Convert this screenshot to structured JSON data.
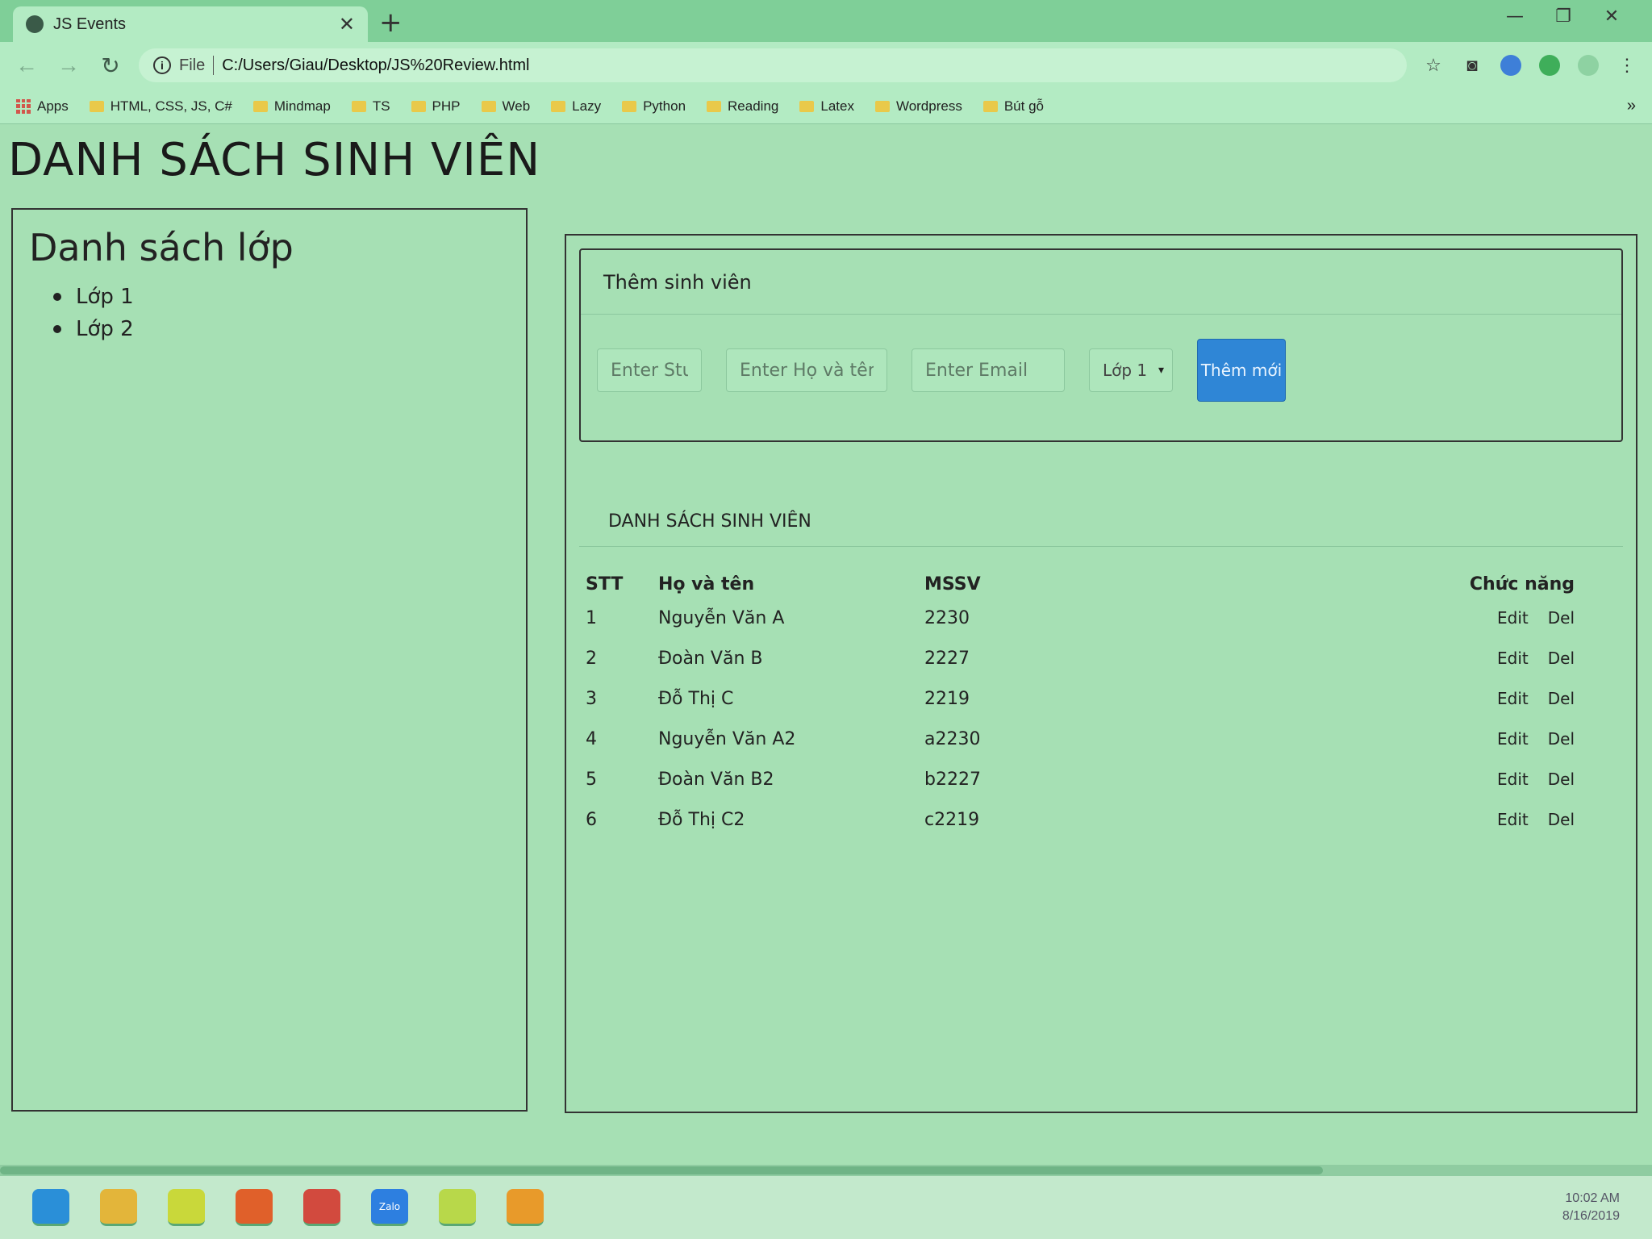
{
  "browser": {
    "tab_title": "JS Events",
    "tab_close": "✕",
    "new_tab": "+",
    "omnibox_scheme": "File",
    "url": "C:/Users/Giau/Desktop/JS%20Review.html",
    "bookmarks": [
      "Apps",
      "HTML, CSS, JS, C#",
      "Mindmap",
      "TS",
      "PHP",
      "Web",
      "Lazy",
      "Python",
      "Reading",
      "Latex",
      "Wordpress",
      "Bút gỗ"
    ],
    "bookmarks_more": "»"
  },
  "page": {
    "title": "DANH SÁCH SINH VIÊN",
    "sidebar": {
      "heading": "Danh sách lớp",
      "classes": [
        "Lớp 1",
        "Lớp 2"
      ]
    },
    "add_form": {
      "header": "Thêm sinh viên",
      "id_placeholder": "Enter Student ID",
      "name_placeholder": "Enter Họ và tên",
      "email_placeholder": "Enter Email",
      "class_selected": "Lớp 1",
      "submit_label": "Thêm mới"
    },
    "list": {
      "header": "DANH SÁCH SINH VIÊN",
      "columns": [
        "STT",
        "Họ và tên",
        "MSSV",
        "Chức năng"
      ],
      "edit_label": "Edit",
      "del_label": "Del",
      "rows": [
        {
          "stt": "1",
          "name": "Nguyễn Văn A",
          "mssv": "2230"
        },
        {
          "stt": "2",
          "name": "Đoàn Văn B",
          "mssv": "2227"
        },
        {
          "stt": "3",
          "name": "Đỗ Thị C",
          "mssv": "2219"
        },
        {
          "stt": "4",
          "name": "Nguyễn Văn A2",
          "mssv": "a2230"
        },
        {
          "stt": "5",
          "name": "Đoàn Văn B2",
          "mssv": "b2227"
        },
        {
          "stt": "6",
          "name": "Đỗ Thị C2",
          "mssv": "c2219"
        }
      ]
    }
  },
  "taskbar": {
    "time": "10:02 AM",
    "date": "8/16/2019",
    "apps": [
      "edge-icon",
      "file-explorer-icon",
      "sticky-notes-icon",
      "firefox-icon",
      "chrome-icon",
      "zalo-icon",
      "notepad-icon",
      "sublime-icon"
    ],
    "zalo_label": "Zalo"
  },
  "colors": {
    "page_bg": "#a6e0b4",
    "primary_button": "#2f86d6"
  }
}
